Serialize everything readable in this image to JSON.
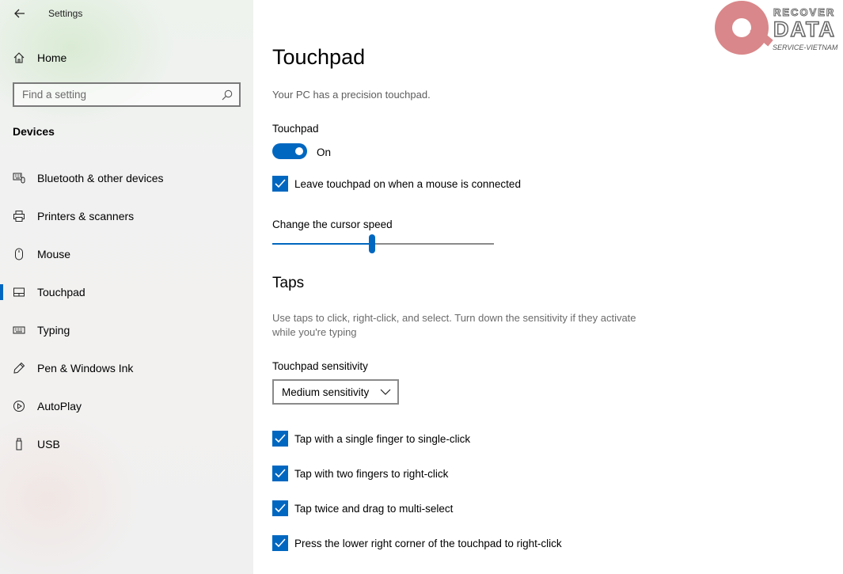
{
  "window": {
    "title": "Settings"
  },
  "sidebar": {
    "home_label": "Home",
    "search_placeholder": "Find a setting",
    "section_heading": "Devices",
    "items": [
      {
        "label": "Bluetooth & other devices",
        "icon": "bluetooth-devices-icon"
      },
      {
        "label": "Printers & scanners",
        "icon": "printer-icon"
      },
      {
        "label": "Mouse",
        "icon": "mouse-icon"
      },
      {
        "label": "Touchpad",
        "icon": "touchpad-icon",
        "active": true
      },
      {
        "label": "Typing",
        "icon": "keyboard-icon"
      },
      {
        "label": "Pen & Windows Ink",
        "icon": "pen-icon"
      },
      {
        "label": "AutoPlay",
        "icon": "autoplay-icon"
      },
      {
        "label": "USB",
        "icon": "usb-icon"
      }
    ]
  },
  "main": {
    "title": "Touchpad",
    "description": "Your PC has a precision touchpad.",
    "touchpad_toggle": {
      "label": "Touchpad",
      "state": "On",
      "checked": true
    },
    "leave_on_checkbox": {
      "label": "Leave touchpad on when a mouse is connected",
      "checked": true
    },
    "cursor_speed": {
      "label": "Change the cursor speed",
      "value_fraction": 0.45
    },
    "taps": {
      "heading": "Taps",
      "description": "Use taps to click, right-click, and select. Turn down the sensitivity if they activate while you're typing",
      "sensitivity_label": "Touchpad sensitivity",
      "sensitivity_value": "Medium sensitivity",
      "options": [
        {
          "label": "Tap with a single finger to single-click",
          "checked": true
        },
        {
          "label": "Tap with two fingers to right-click",
          "checked": true
        },
        {
          "label": "Tap twice and drag to multi-select",
          "checked": true
        },
        {
          "label": "Press the lower right corner of the touchpad to right-click",
          "checked": true
        }
      ]
    }
  },
  "watermark": {
    "line1": "RECOVER",
    "line2": "DATA",
    "line3": "SERVICE-VIETNAM"
  },
  "colors": {
    "accent": "#0067c0",
    "watermark": "#d9878a"
  }
}
